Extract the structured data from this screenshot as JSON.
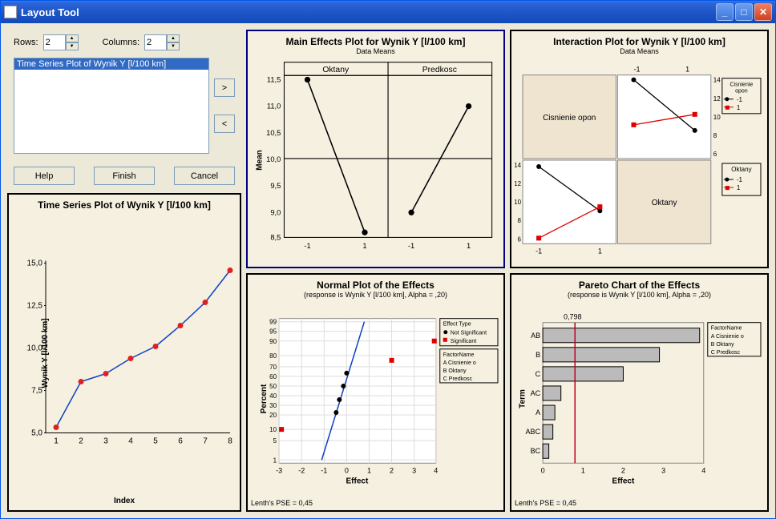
{
  "window": {
    "title": "Layout Tool"
  },
  "controls": {
    "rows_label": "Rows:",
    "rows_value": "2",
    "cols_label": "Columns:",
    "cols_value": "2",
    "list_item": "Time Series Plot of Wynik Y [l/100 km]",
    "btn_right": ">",
    "btn_left": "<",
    "btn_help": "Help",
    "btn_finish": "Finish",
    "btn_cancel": "Cancel"
  },
  "preview": {
    "title": "Time Series Plot of Wynik Y [l/100 km]",
    "ylabel": "Wynik Y [l/100 km]",
    "xlabel": "Index"
  },
  "main_effects": {
    "title": "Main Effects Plot for Wynik Y [l/100 km]",
    "subtitle": "Data Means",
    "panel1": "Oktany",
    "panel2": "Predkosc",
    "ylabel": "Mean"
  },
  "interaction": {
    "title": "Interaction Plot for Wynik Y [l/100 km]",
    "subtitle": "Data Means",
    "label_cisn": "Cisnienie opon",
    "label_okt": "Oktany",
    "leg1_title": "Cisnienie opon",
    "leg1_a": "-1",
    "leg1_b": "1",
    "leg2_title": "Oktany",
    "leg2_a": "-1",
    "leg2_b": "1"
  },
  "normal": {
    "title": "Normal Plot of the Effects",
    "subtitle": "(response is Wynik Y [l/100 km], Alpha = ,20)",
    "ylabel": "Percent",
    "xlabel": "Effect",
    "footnote": "Lenth's PSE = 0,45",
    "leg_title": "Effect Type",
    "leg_a": "Not Significant",
    "leg_b": "Significant",
    "leg2_title": "FactorName",
    "leg2_rows": [
      "A   Cisnienie o",
      "B   Oktany",
      "C   Predkosc"
    ]
  },
  "pareto": {
    "title": "Pareto Chart of the Effects",
    "subtitle": "(response is Wynik Y [l/100 km], Alpha = ,20)",
    "ylabel": "Term",
    "xlabel": "Effect",
    "footnote": "Lenth's PSE = 0,45",
    "cutoff": "0,798",
    "leg_title": "FactorName",
    "leg_rows": [
      "A   Cisnienie o",
      "B   Oktany",
      "C   Predkosc"
    ]
  },
  "chart_data": [
    {
      "type": "line",
      "name": "time_series",
      "title": "Time Series Plot of Wynik Y [l/100 km]",
      "xlabel": "Index",
      "ylabel": "Wynik Y [l/100 km]",
      "x": [
        1,
        2,
        3,
        4,
        5,
        6,
        7,
        8
      ],
      "y": [
        5.3,
        8.0,
        8.5,
        9.4,
        10.1,
        11.3,
        12.7,
        14.6
      ],
      "ylim": [
        5.0,
        15.0
      ],
      "yticks": [
        5.0,
        7.5,
        10.0,
        12.5,
        15.0
      ],
      "xticks": [
        1,
        2,
        3,
        4,
        5,
        6,
        7,
        8
      ]
    },
    {
      "type": "line",
      "name": "main_effects",
      "title": "Main Effects Plot for Wynik Y [l/100 km]",
      "ylabel": "Mean",
      "panels": [
        {
          "label": "Oktany",
          "x": [
            -1,
            1
          ],
          "y": [
            11.5,
            8.6
          ]
        },
        {
          "label": "Predkosc",
          "x": [
            -1,
            1
          ],
          "y": [
            9.0,
            11.0
          ]
        }
      ],
      "ylim": [
        8.5,
        11.5
      ],
      "yticks": [
        8.5,
        9.0,
        9.5,
        10.0,
        10.5,
        11.0,
        11.5
      ]
    },
    {
      "type": "line",
      "name": "interaction",
      "title": "Interaction Plot for Wynik Y [l/100 km]",
      "matrix": [
        [
          {
            "kind": "label",
            "text": "Cisnienie opon"
          },
          {
            "kind": "plot",
            "xticks": [
              -1,
              1
            ],
            "yticks": [
              6,
              8,
              10,
              12,
              14
            ],
            "series": [
              {
                "name": "-1",
                "color": "black",
                "y": [
                  13.5,
                  8.6
                ]
              },
              {
                "name": "1",
                "color": "red",
                "y": [
                  9.2,
                  10.2
                ]
              }
            ]
          }
        ],
        [
          {
            "kind": "plot",
            "xticks": [
              -1,
              1
            ],
            "yticks": [
              6,
              8,
              10,
              12,
              14
            ],
            "series": [
              {
                "name": "-1",
                "color": "black",
                "y": [
                  13.7,
                  9.4
                ]
              },
              {
                "name": "1",
                "color": "red",
                "y": [
                  6.5,
                  9.8
                ]
              }
            ]
          },
          {
            "kind": "label",
            "text": "Oktany"
          }
        ]
      ]
    },
    {
      "type": "scatter",
      "name": "normal_plot",
      "title": "Normal Plot of the Effects",
      "xlabel": "Effect",
      "ylabel": "Percent",
      "xlim": [
        -3,
        4
      ],
      "xticks": [
        -3,
        -2,
        -1,
        0,
        1,
        2,
        3,
        4
      ],
      "yticks": [
        1,
        5,
        10,
        20,
        30,
        40,
        50,
        60,
        70,
        80,
        90,
        95,
        99
      ],
      "fit_line": {
        "x1": -1.1,
        "y1": 2,
        "x2": 0.8,
        "y2": 98
      },
      "points": [
        {
          "x": -2.9,
          "y": 10,
          "color": "red",
          "shape": "square",
          "sig": true
        },
        {
          "x": -0.45,
          "y": 24,
          "color": "black",
          "shape": "circle",
          "sig": false
        },
        {
          "x": -0.3,
          "y": 37,
          "color": "black",
          "shape": "circle",
          "sig": false
        },
        {
          "x": -0.15,
          "y": 50,
          "color": "black",
          "shape": "circle",
          "sig": false
        },
        {
          "x": 0.0,
          "y": 63,
          "color": "black",
          "shape": "circle",
          "sig": false
        },
        {
          "x": 2.0,
          "y": 77,
          "color": "red",
          "shape": "square",
          "sig": true
        },
        {
          "x": 3.9,
          "y": 90,
          "color": "red",
          "shape": "square",
          "sig": true
        }
      ]
    },
    {
      "type": "bar",
      "name": "pareto",
      "title": "Pareto Chart of the Effects",
      "xlabel": "Effect",
      "ylabel": "Term",
      "orientation": "h",
      "categories": [
        "AB",
        "B",
        "C",
        "AC",
        "A",
        "ABC",
        "BC"
      ],
      "values": [
        3.9,
        2.9,
        2.0,
        0.45,
        0.3,
        0.25,
        0.15
      ],
      "xlim": [
        0,
        4
      ],
      "xticks": [
        0,
        1,
        2,
        3,
        4
      ],
      "cutoff": 0.798
    }
  ]
}
